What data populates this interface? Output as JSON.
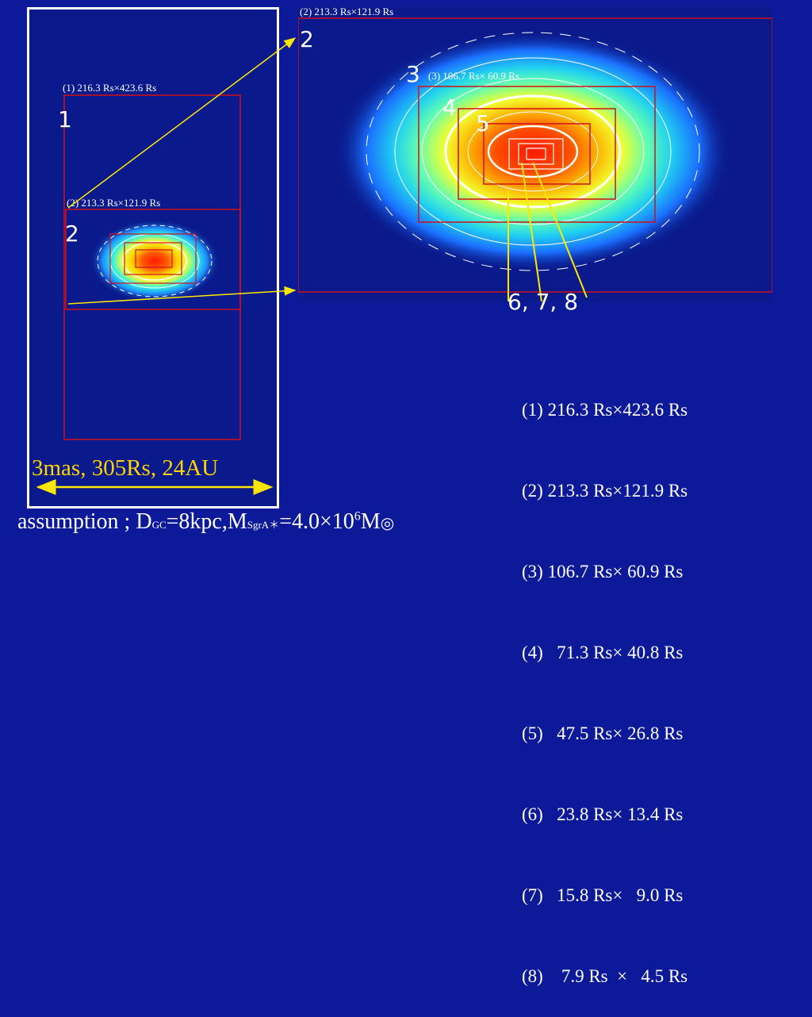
{
  "left_panel": {
    "box1_label": "(1) 216.3 Rs×423.6 Rs",
    "box1_num": "1",
    "box2_label": "(2) 213.3 Rs×121.9 Rs",
    "box2_num": "2"
  },
  "right_panel": {
    "box2_label": "(2) 213.3 Rs×121.9 Rs",
    "box2_num": "2",
    "box3_label": "(3) 106.7 Rs× 60.9 Rs",
    "box3_num": "3",
    "box4_num": "4",
    "box5_num": "5",
    "inner_nums": "6,  7,  8"
  },
  "size_list": [
    "(1) 216.3 Rs×423.6 Rs",
    "(2) 213.3 Rs×121.9 Rs",
    "(3) 106.7 Rs× 60.9 Rs",
    "(4)   71.3 Rs× 40.8 Rs",
    "(5)   47.5 Rs× 26.8 Rs",
    "(6)   23.8 Rs× 13.4 Rs",
    "(7)   15.8 Rs×   9.0 Rs",
    "(8)    7.9 Rs  ×   4.5 Rs"
  ],
  "scale_bar": {
    "text": "3mas,  305Rs,  24AU"
  },
  "assumption": {
    "prefix": "assumption ; D",
    "gc_sub": "GC",
    "mid": "=8kpc,M",
    "sgra_sub": "SgrA＊",
    "value": "=4.0×10",
    "exp": "6",
    "unit": "M",
    "sun_symbol": "◎"
  },
  "colors": {
    "background": "#0c1a9a",
    "box_border": "#d0101a",
    "arrow": "#ffe600",
    "scale_text": "#ffd400"
  }
}
